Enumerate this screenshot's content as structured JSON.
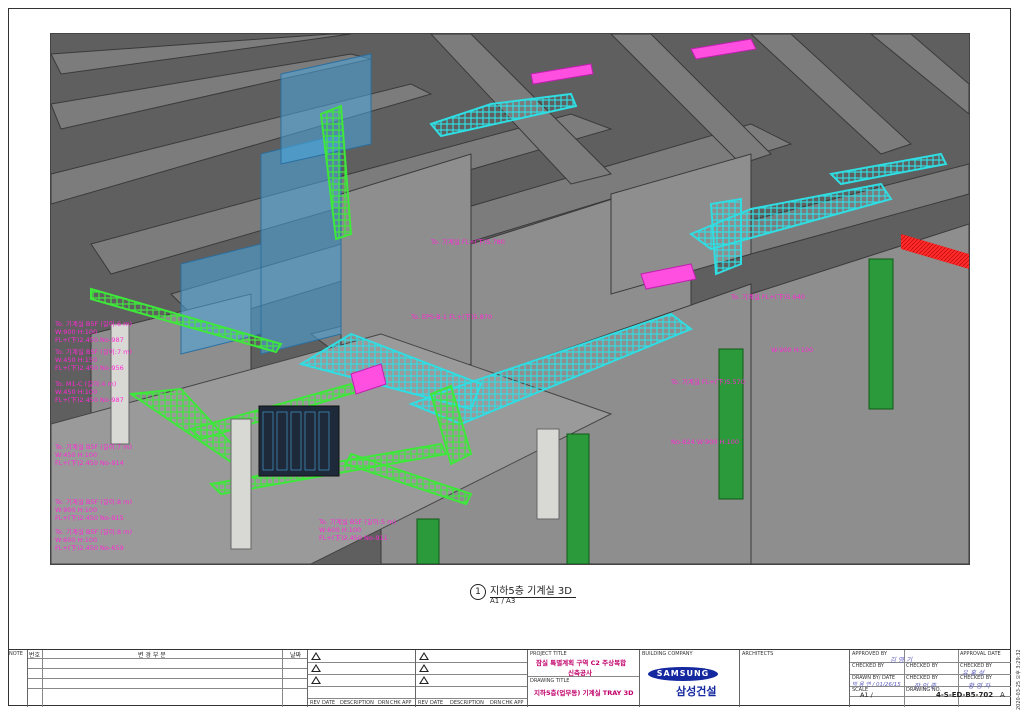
{
  "viewport": {
    "colors": {
      "tray_main": "#33e3e8",
      "tray_green": "#35e835",
      "tag": "#ff2ad4",
      "column": "#2a9a3a",
      "bg": "#6b6b6b",
      "glass": "#4aa8e0",
      "red_zone": "#ff2020"
    },
    "tags": [
      {
        "text": "To. 기계실 B5F (길이:6 m)"
      },
      {
        "text": "W:900 H:100"
      },
      {
        "text": "FL+(下)2.450 No-987"
      },
      {
        "text": "To. 기계실 B5F (길이:7 m)"
      },
      {
        "text": "W:450 H:150"
      },
      {
        "text": "FL+(下)2.450 No-956"
      },
      {
        "text": "To. M1-C (길이:4 m)"
      },
      {
        "text": "W:450 H:100"
      },
      {
        "text": "FL+(下)2.450 No-987"
      },
      {
        "text": "To. 기계실 B5F (길이:7 m)"
      },
      {
        "text": "W:450 H:100"
      },
      {
        "text": "FL+(下)2.450 No-914"
      },
      {
        "text": "To. 기계실 B5F (길이:8 m)"
      },
      {
        "text": "W:900 H:100"
      },
      {
        "text": "FL+(下)2.450 No-915"
      },
      {
        "text": "To. 기계실 B5F (길이:8 m)"
      },
      {
        "text": "W:600 H:100"
      },
      {
        "text": "FL+(下)2.450 No-659"
      },
      {
        "text": "To. 기계실 B5F (길이:5 m)"
      },
      {
        "text": "W:600 H:100"
      },
      {
        "text": "FL+(下)2.450 No-911"
      },
      {
        "text": "To. EPS-B-1 FL+(下)5.870"
      },
      {
        "text": "To. 기계실 FL+(下)5.780"
      },
      {
        "text": "To. 기계실 FL+(下)5.640"
      },
      {
        "text": "To. 기계실 FL+(下)5.570"
      },
      {
        "text": "W:900 H:100"
      },
      {
        "text": "No-824 W:900 H:100"
      }
    ]
  },
  "caption": {
    "number": "1",
    "title": "지하5층 기계실 3D",
    "scale": "A1 / A3"
  },
  "titleblock": {
    "note_label": "NOTE",
    "rev_headers": {
      "no": "번호",
      "desc": "변 경 부 분",
      "date": "날짜"
    },
    "rev_table_headers": [
      "REV",
      "DATE",
      "DESCRIPTION",
      "DRN",
      "CHK",
      "APP",
      "REV",
      "DATE",
      "DESCRIPTION",
      "DRN",
      "CHK",
      "APP"
    ],
    "project_title_label": "PROJECT TITLE",
    "project_title": "잠실 특별계획 구역 C2 주상복합",
    "project_subtitle": "신축공사",
    "drawing_title_label": "DRAWING TITLE",
    "drawing_title": "지하5층(업무동) 기계실 TRAY 3D",
    "building_company_label": "BUILDING COMPANY",
    "logo_text": "SAMSUNG",
    "company_name": "삼성건설",
    "architects_label": "ARCHITECTS",
    "approved_by_label": "APPROVED BY",
    "approved_by": "김 영 기",
    "approval_date_label": "APPROVAL DATE",
    "checked_by_label": "CHECKED BY",
    "checked_by_1": "유 홍 성",
    "drawn_by_label": "DRAWN BY/ DATE",
    "drawn_by": "박 용 연 / 01/26/15",
    "checked_by_2": "장 인 준",
    "checked_by_3": "황 영 자",
    "scale_label": "SCALE",
    "scale": "A1 /",
    "drawing_no_label": "DRAWING NO.",
    "drawing_no": "4-S-ED-B5-702",
    "sheet_rev": "A"
  },
  "side_stamp": "2020-03-25 오후 3:29:32"
}
